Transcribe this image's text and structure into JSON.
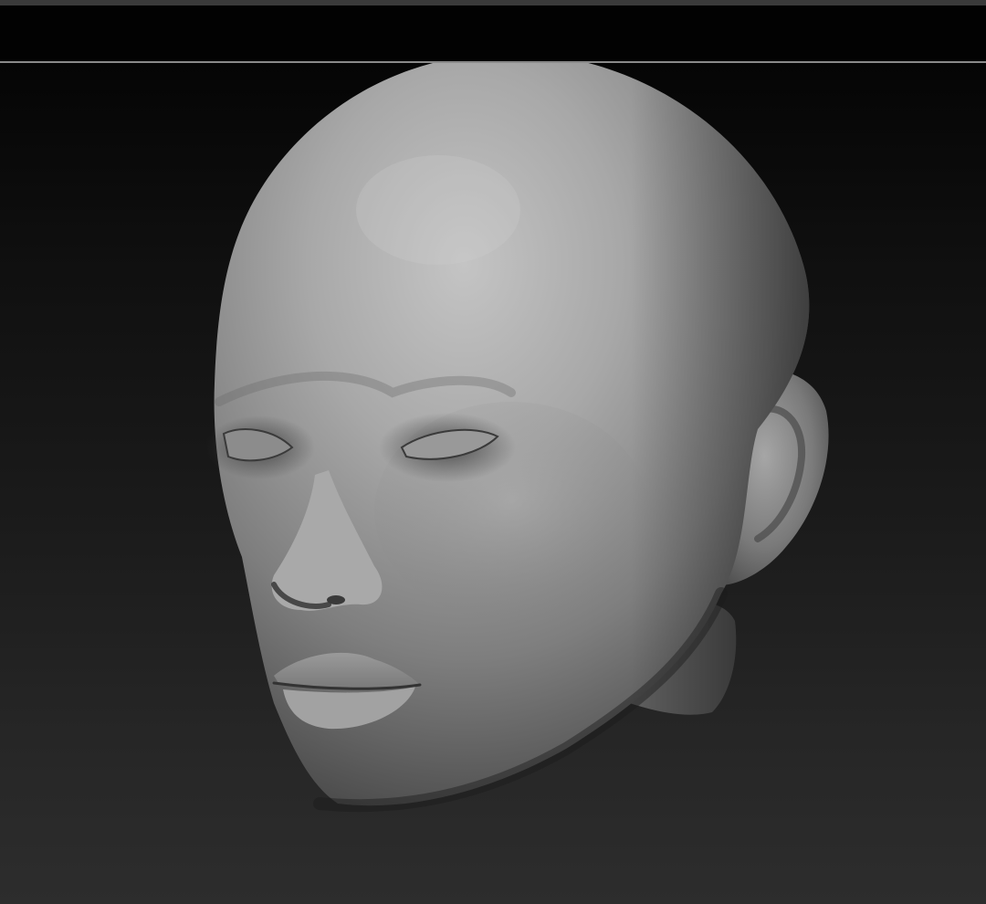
{
  "window": {
    "title": ""
  },
  "viewport": {
    "background_top": "#050505",
    "background_bottom": "#2d2d2d",
    "separator_color": "#8a8a8a",
    "top_bar_color": "#3a3a3a"
  },
  "model": {
    "material_color": "#8a8a8a",
    "highlight_color": "#bdbdbd",
    "shadow_color": "#2a2a2a"
  },
  "icons": [
    "sculpt-head-model"
  ]
}
